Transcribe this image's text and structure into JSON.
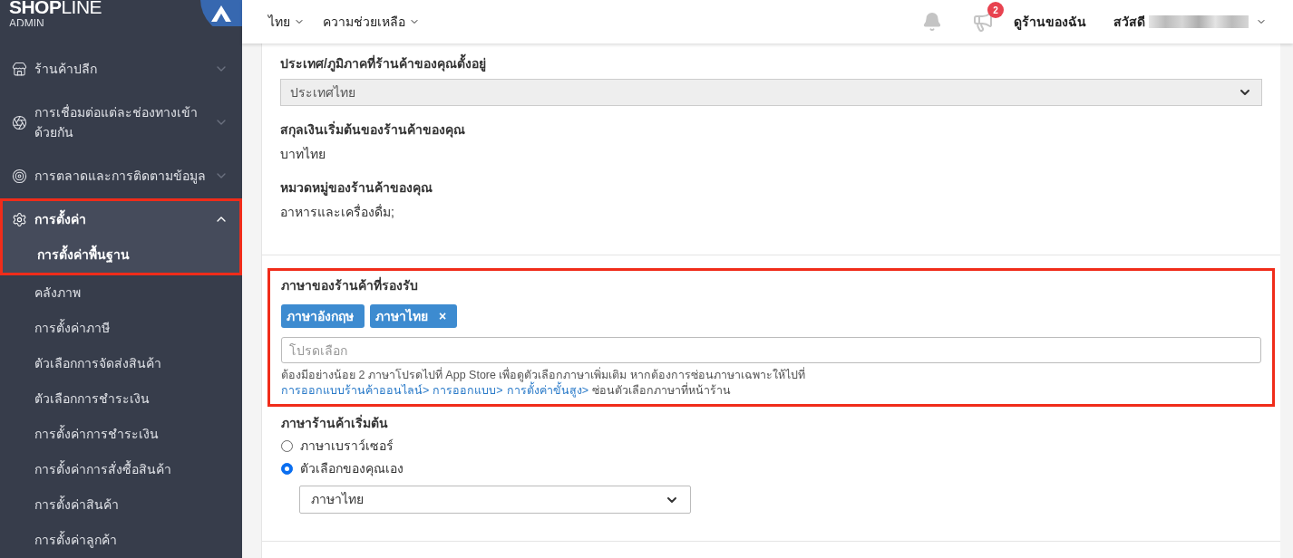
{
  "sidebar": {
    "logo": {
      "brand": "**SHOP**LINE",
      "sub": "ADMIN"
    },
    "items": [
      {
        "label": "ร้านค้าปลีก",
        "expanded": false,
        "highlighted": false
      },
      {
        "label": "การเชื่อมต่อแต่ละช่องทางเข้าด้วยกัน",
        "expanded": false,
        "highlighted": false
      },
      {
        "label": "การตลาดและการติดตามข้อมูล",
        "expanded": false,
        "highlighted": false
      },
      {
        "label": "การตั้งค่า",
        "expanded": true,
        "highlighted": true,
        "children": [
          {
            "label": "การตั้งค่าพื้นฐาน",
            "selected": true
          },
          {
            "label": "คลังภาพ",
            "selected": false
          },
          {
            "label": "การตั้งค่าภาษี",
            "selected": false
          },
          {
            "label": "ตัวเลือกการจัดส่งสินค้า",
            "selected": false
          },
          {
            "label": "ตัวเลือกการชำระเงิน",
            "selected": false
          },
          {
            "label": "การตั้งค่าการชำระเงิน",
            "selected": false
          },
          {
            "label": "การตั้งค่าการสั่งซื้อสินค้า",
            "selected": false
          },
          {
            "label": "การตั้งค่าสินค้า",
            "selected": false
          },
          {
            "label": "การตั้งค่าลูกค้า",
            "selected": false
          }
        ]
      }
    ]
  },
  "topbar": {
    "menus": [
      {
        "label": "ไทย"
      },
      {
        "label": "ความช่วยเหลือ"
      }
    ],
    "announcement_badge": "2",
    "view_store": "ดูร้านของฉัน",
    "greeting": "สวัสดี"
  },
  "store_info": [
    {
      "label": "ประเทศ/ภูมิภาคที่ร้านค้าของคุณตั้งอยู่",
      "kind": "select",
      "value": "ประเทศไทย"
    },
    {
      "label": "สกุลเงินเริ่มต้นของร้านค้าของคุณ",
      "kind": "text",
      "value": "บาทไทย"
    },
    {
      "label": "หมวดหมู่ของร้านค้าของคุณ",
      "kind": "text",
      "value": "อาหารและเครื่องดื่ม;"
    }
  ],
  "languages": {
    "highlighted": true,
    "title": "ภาษาของร้านค้าที่รองรับ",
    "tags": [
      {
        "label": "ภาษาอังกฤษ",
        "removable": false
      },
      {
        "label": "ภาษาไทย",
        "removable": true,
        "remove": "×"
      }
    ],
    "placeholder": "โปรดเลือก",
    "help": "ต้องมีอย่างน้อย 2 ภาษาโปรดไปที่ App Store เพื่อดูตัวเลือกภาษาเพิ่มเติม หากต้องการซ่อนภาษาเฉพาะให้ไปที่",
    "links": [
      "การออกแบบร้านค้าออนไลน์>",
      "การออกแบบ>",
      "การตั้งค่าขั้นสูง>"
    ],
    "help_end": "ซ่อนตัวเลือกภาษาที่หน้าร้าน"
  },
  "default_language": {
    "title": "ภาษาร้านค้าเริ่มต้น",
    "options": [
      {
        "label": "ภาษาเบราว์เซอร์",
        "selected": false
      },
      {
        "label": "ตัวเลือกของคุณเอง",
        "selected": true
      }
    ],
    "value": "ภาษาไทย"
  }
}
